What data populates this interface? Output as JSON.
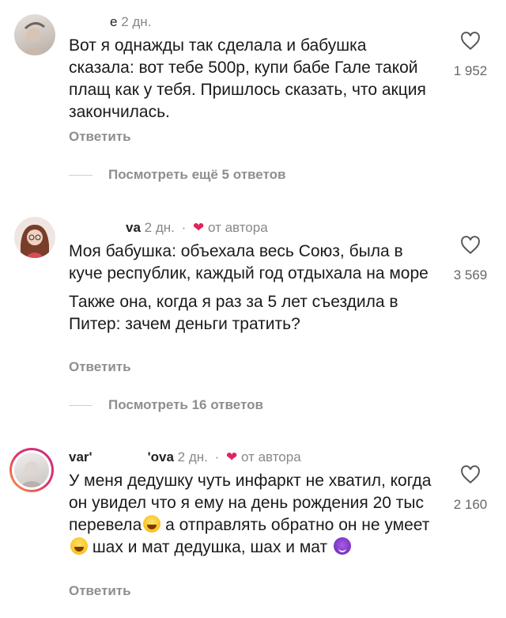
{
  "colors": {
    "accent_heart": "#e0245e",
    "muted": "#8e8e8e"
  },
  "comments": [
    {
      "username": "",
      "fragment": "e",
      "time": "2 дн.",
      "author_badge": "",
      "paragraphs": [
        "Вот я однажды так сделала и бабушка сказала: вот тебе 500р, купи бабе Гале такой плащ как у тебя. Пришлось сказать, что акция закончилась."
      ],
      "likes": "1 952",
      "reply_label": "Ответить",
      "more_label": "Посмотреть ещё 5 ответов"
    },
    {
      "username": "va",
      "time": "2 дн.",
      "author_badge": "от автора",
      "paragraphs": [
        "Моя бабушка: объехала весь Союз, была в куче республик, каждый год отдыхала на море",
        "Также она, когда я раз за 5 лет съездила в Питер: зачем деньги тратить?"
      ],
      "likes": "3 569",
      "reply_label": "Ответить",
      "more_label": "Посмотреть 16 ответов"
    },
    {
      "username_left": "var'",
      "username_right": "'ova",
      "time": "2 дн.",
      "author_badge": "от автора",
      "text_parts": [
        "У меня дедушку чуть инфаркт не хватил, когда он увидел что я ему на день рождения 20 тыс перевела",
        " а отправлять обратно он не умеет",
        " шах и мат дедушка, шах и мат "
      ],
      "likes": "2 160",
      "reply_label": "Ответить"
    }
  ],
  "icons": {
    "like": "heart-outline-icon",
    "author_heart": "heart-filled-icon",
    "emoji_laugh": "laughing-emoji-icon",
    "emoji_devil": "devil-emoji-icon"
  }
}
